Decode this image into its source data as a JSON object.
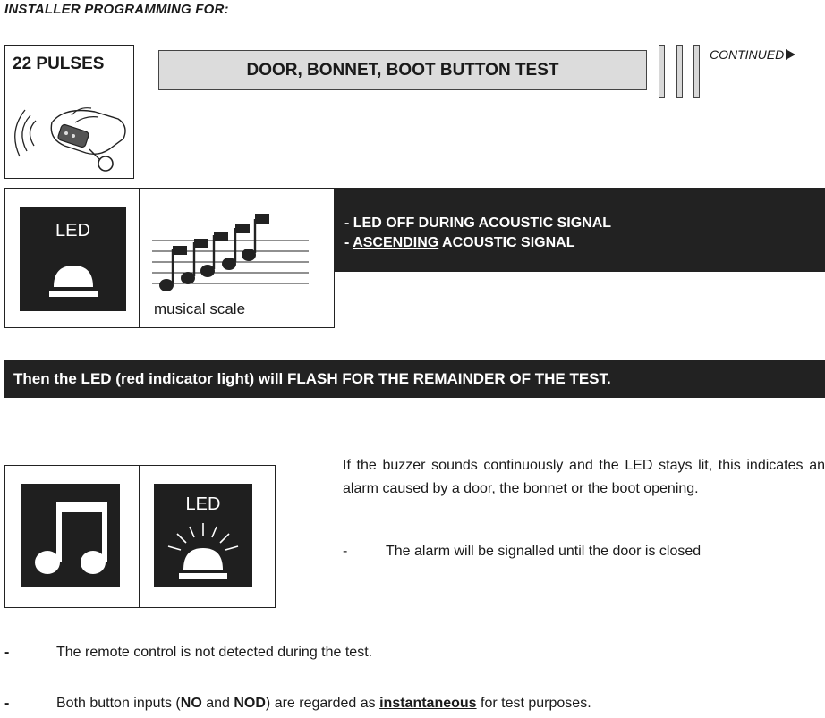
{
  "header": {
    "title": "INSTALLER PROGRAMMING FOR:"
  },
  "pulses": {
    "label": "22 PULSES",
    "icon": "hand-remote-control-icon"
  },
  "title_box": {
    "label": "DOOR, BONNET, BOOT BUTTON TEST"
  },
  "continued": {
    "label": "CONTINUED",
    "icon": "right-triangle-arrow-icon"
  },
  "led_icon": {
    "label": "LED",
    "icon": "led-off-icon"
  },
  "scale_icon": {
    "label": "musical scale",
    "icon": "ascending-notes-icon"
  },
  "signal_notes": {
    "line1": "- LED OFF DURING ACOUSTIC SIGNAL",
    "line2_prefix": "- ",
    "line2_underlined": "ASCENDING",
    "line2_suffix": " ACOUSTIC SIGNAL"
  },
  "flash_banner": {
    "text": "Then the LED (red indicator light) will FLASH FOR THE REMAINDER OF THE TEST."
  },
  "alarm_icons": {
    "note_icon": "music-note-icon",
    "led_label": "LED",
    "led_icon": "led-flashing-icon"
  },
  "alarm_paragraph": {
    "text": "If the buzzer sounds continuously and the LED stays lit, this indicates an alarm caused by a door, the bonnet or the boot opening."
  },
  "alarm_dash": {
    "dash": "-",
    "text": "The alarm will be signalled until the door is closed"
  },
  "bullets": {
    "b1": {
      "dash": "-",
      "text": "The remote control is not detected during the test."
    },
    "b2": {
      "dash": "-",
      "t1": "Both button inputs (",
      "t2": "NO",
      "t3": " and ",
      "t4": "NOD",
      "t5": ") are regarded as ",
      "t6": "instantaneous",
      "t7": " for test purposes."
    }
  }
}
